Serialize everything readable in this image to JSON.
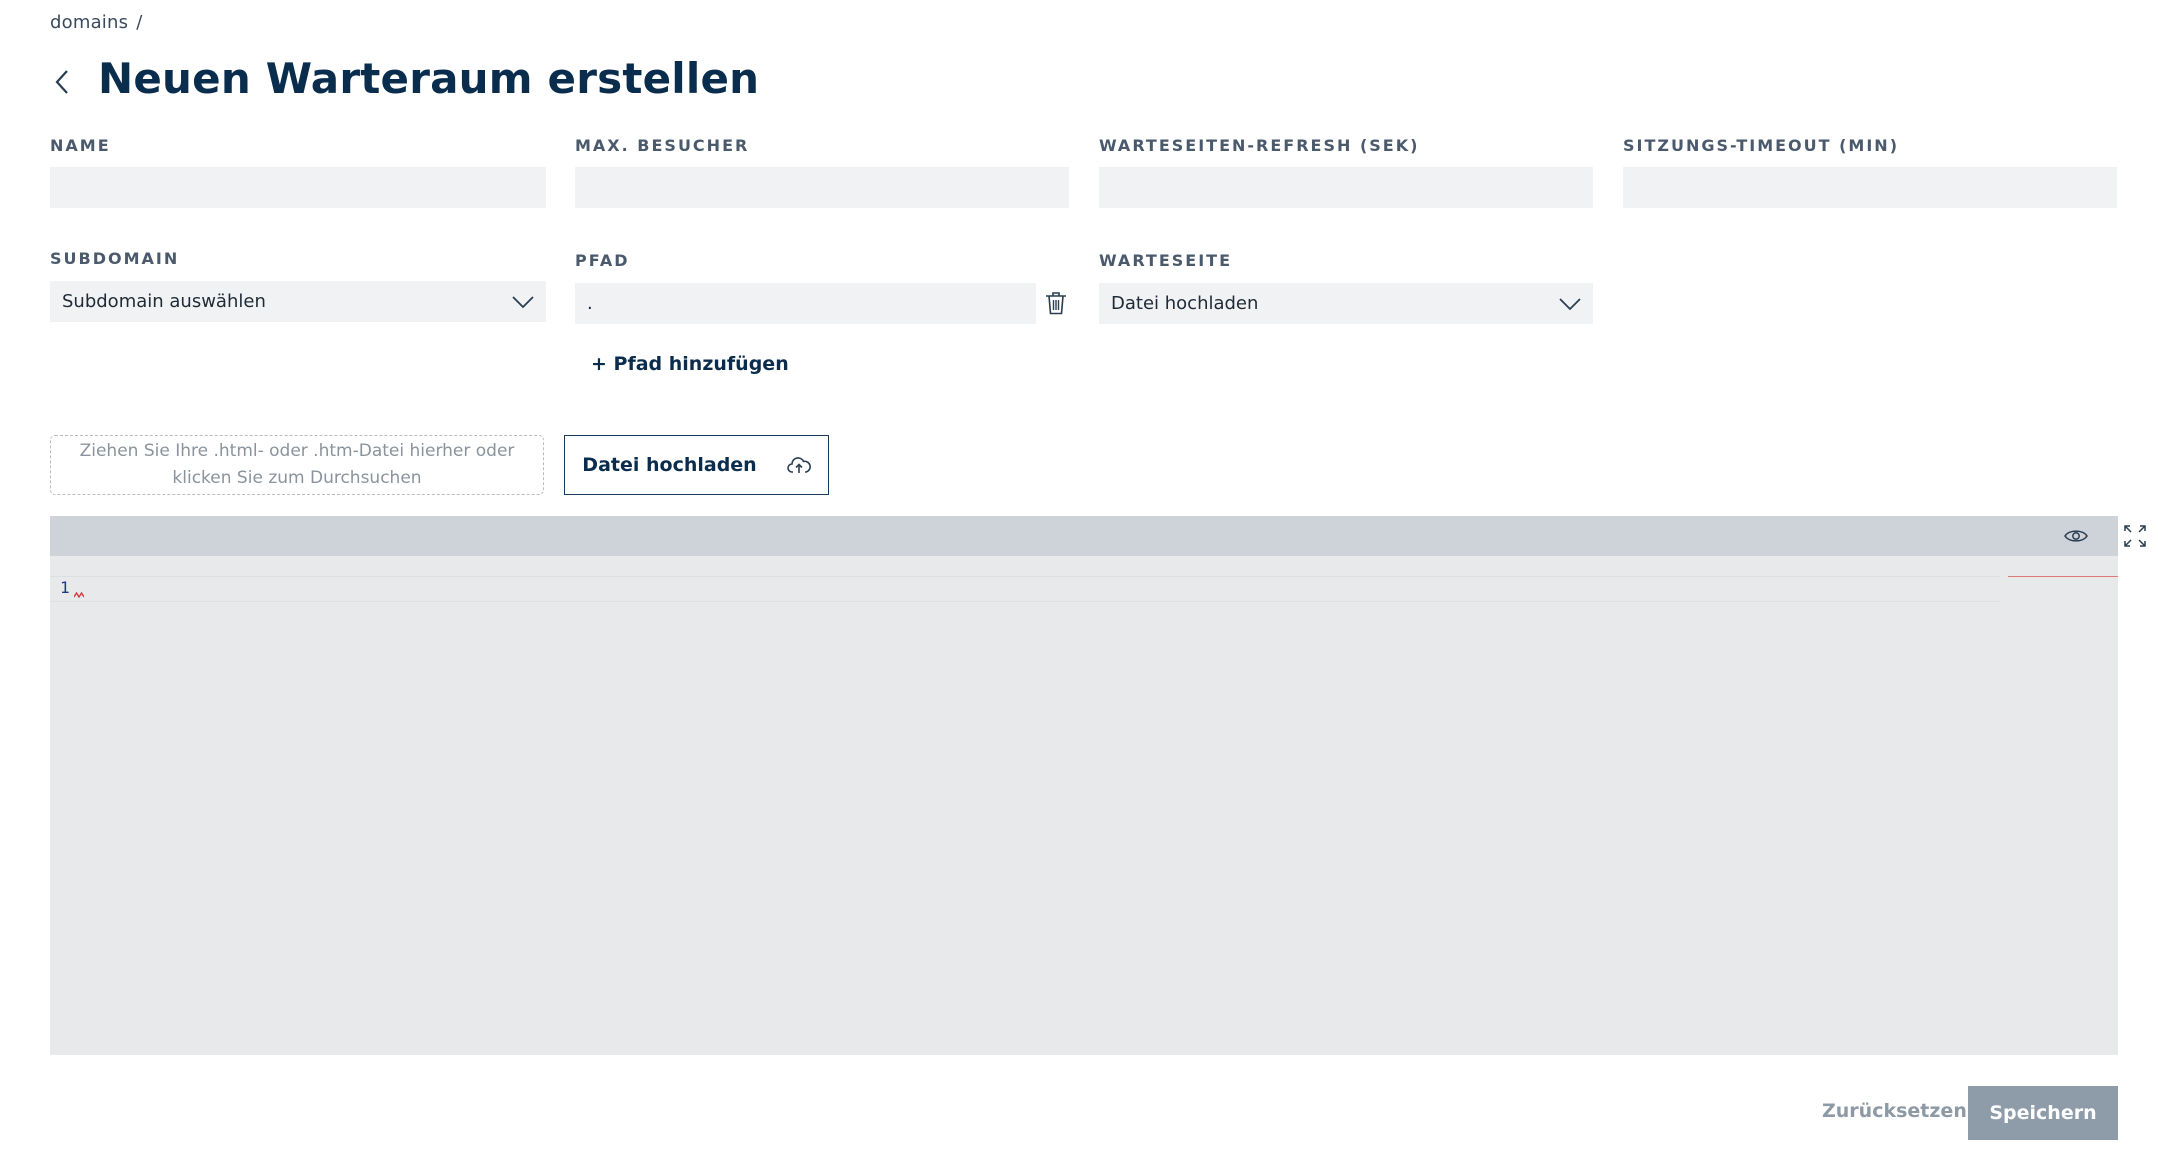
{
  "breadcrumb": {
    "item": "domains",
    "separator": "/"
  },
  "header": {
    "title": "Neuen Warteraum erstellen"
  },
  "fields": {
    "name": {
      "label": "NAME",
      "value": ""
    },
    "max_visitors": {
      "label": "MAX. BESUCHER",
      "value": ""
    },
    "refresh": {
      "label": "WARTESEITEN-REFRESH (SEK)",
      "value": ""
    },
    "timeout": {
      "label": "SITZUNGS-TIMEOUT (MIN)",
      "value": ""
    },
    "subdomain": {
      "label": "SUBDOMAIN",
      "selected": "Subdomain auswählen"
    },
    "path": {
      "label": "PFAD",
      "value": "."
    },
    "waiting_page": {
      "label": "WARTESEITE",
      "selected": "Datei hochladen"
    }
  },
  "add_path_label": "+ Pfad hinzufügen",
  "dropzone_text": "Ziehen Sie Ihre .html- oder .htm-Datei hierher oder klicken Sie zum Durchsuchen",
  "upload_button_label": "Datei hochladen",
  "editor": {
    "line_number": "1"
  },
  "actions": {
    "reset_label": "Zurücksetzen",
    "save_label": "Speichern"
  },
  "icons": {
    "back": "chevron-left-icon",
    "trash": "trash-icon",
    "cloud": "cloud-upload-icon",
    "eye": "eye-icon",
    "fullscreen": "fullscreen-icon",
    "dropdown": "chevron-down-icon"
  },
  "colors": {
    "primary": "#0b2d4d",
    "input_bg": "#f1f2f3",
    "editor_bg": "#e7e9eb",
    "toolbar_bg": "#cdd3d8",
    "save_button": "#8d9ca8"
  }
}
